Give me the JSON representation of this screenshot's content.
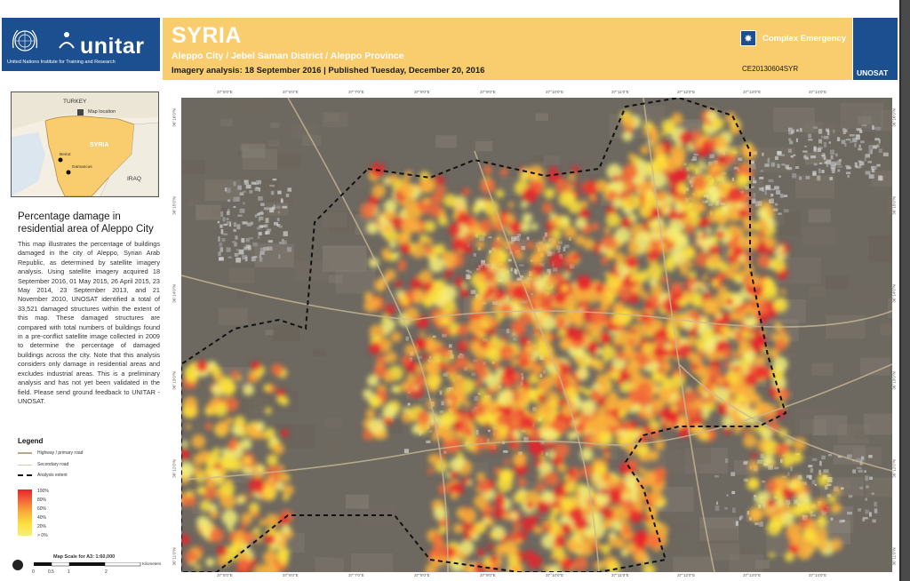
{
  "header": {
    "org": "unitar",
    "org_subtitle": "United Nations Institute for Training and Research",
    "country": "SYRIA",
    "subtitle": "Aleppo City / Jebel Saman District / Aleppo Province",
    "imagery_line": "Imagery analysis: 18 September 2016 | Published Tuesday, December 20, 2016",
    "emergency_label": "Complex Emergency",
    "glide": "CE20130604SYR",
    "unosat": "UNOSAT",
    "band_color": "#f9cc6e",
    "brand_color": "#1b4f8f"
  },
  "inset": {
    "turkey": "TURKEY",
    "syria": "SYRIA",
    "iraq": "IRAQ",
    "map_location": "Map location",
    "beirut": "Beirut",
    "damascus": "Damascus"
  },
  "sidebar": {
    "title": "Percentage damage in residential area of Aleppo City",
    "description": "This map illustrates the percentage of buildings damaged in the city of Aleppo, Syrian Arab Republic, as determined by satellite imagery analysis. Using satellite imagery acquired 18 September 2016, 01 May 2015, 26 April 2015, 23 May 2014, 23 September 2013, and 21 November 2010, UNOSAT identified a total of 33,521 damaged structures within the extent of this map. These damaged structures are compared with total numbers of buildings found in a pre-conflict satellite image collected in 2009 to determine the percentage of damaged buildings across the city. Note that this analysis considers only damage in residential areas and excludes industrial areas. This is a preliminary analysis and has not yet been validated in the field. Please send ground feedback to UNITAR - UNOSAT."
  },
  "legend": {
    "title": "Legend",
    "highway": "Highway / primary road",
    "secondary": "Secondary road",
    "extent": "Analysis extent",
    "ramp_labels": [
      "100%",
      "80%",
      "60%",
      "40%",
      "20%",
      "> 0%"
    ],
    "ramp_colors": [
      "#e8232c",
      "#f26b3a",
      "#f9b03b",
      "#fbe13c",
      "#f4f07a"
    ]
  },
  "scale": {
    "title": "Map Scale for A3: 1:60,000",
    "ticks": [
      "0",
      "0.5",
      "1",
      "2"
    ],
    "unit": "Kilometers"
  },
  "map": {
    "top_ticks": [
      "37°5'0\"E",
      "37°6'0\"E",
      "37°7'0\"E",
      "37°8'0\"E",
      "37°9'0\"E",
      "37°10'0\"E",
      "37°11'0\"E",
      "37°12'0\"E",
      "37°13'0\"E",
      "37°14'0\"E"
    ],
    "bottom_ticks": [
      "37°5'0\"E",
      "37°6'0\"E",
      "37°7'0\"E",
      "37°8'0\"E",
      "37°9'0\"E",
      "37°10'0\"E",
      "37°11'0\"E",
      "37°12'0\"E",
      "37°13'0\"E",
      "37°14'0\"E"
    ],
    "left_ticks": [
      "36°16'0\"N",
      "36°15'0\"N",
      "36°14'0\"N",
      "36°13'0\"N",
      "36°12'0\"N",
      "36°11'0\"N"
    ],
    "right_ticks": [
      "36°16'0\"N",
      "36°15'0\"N",
      "36°14'0\"N",
      "36°13'0\"N",
      "36°12'0\"N",
      "36°11'0\"N"
    ]
  }
}
